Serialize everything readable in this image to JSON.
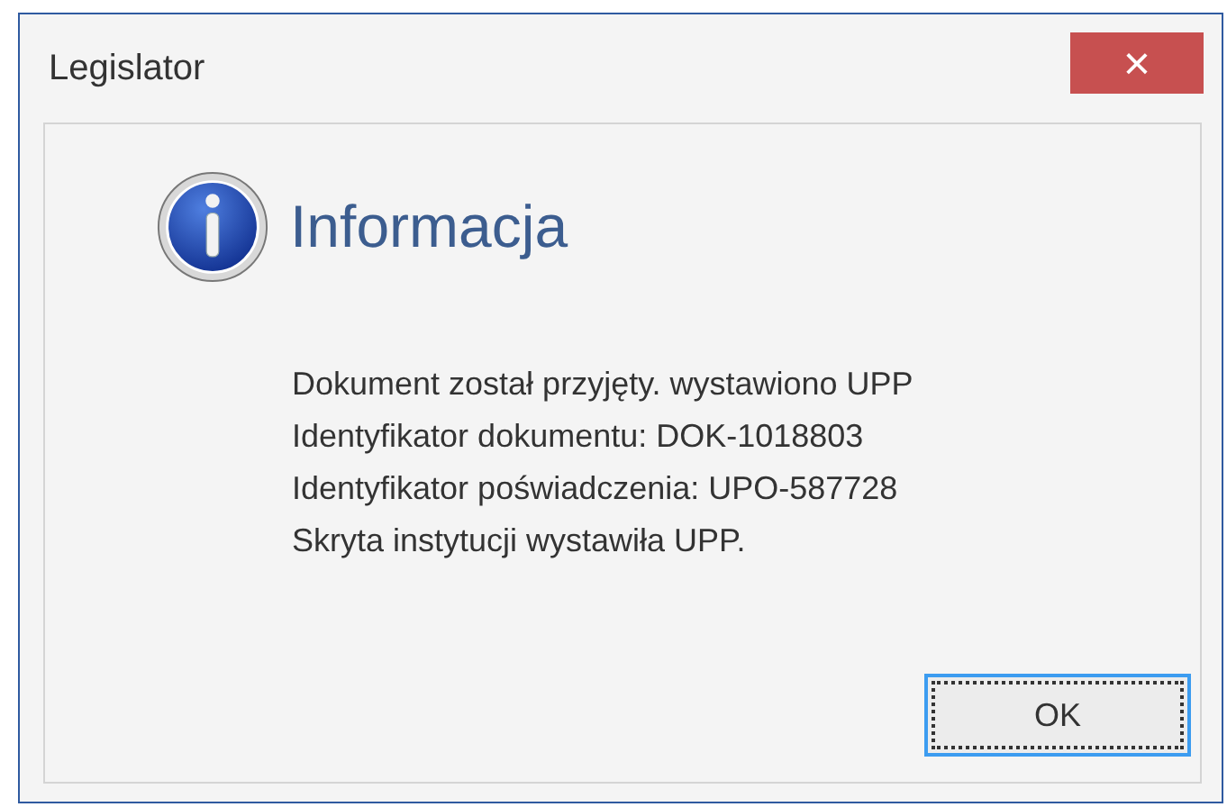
{
  "window": {
    "title": "Legislator",
    "close": "×"
  },
  "heading": "Informacja",
  "lines": [
    "Dokument został przyjęty. wystawiono UPP",
    "Identyfikator dokumentu: DOK-1018803",
    "Identyfikator poświadczenia: UPO-587728",
    "Skryta instytucji wystawiła UPP."
  ],
  "buttons": [
    {
      "label": "OK",
      "focused": true
    }
  ]
}
